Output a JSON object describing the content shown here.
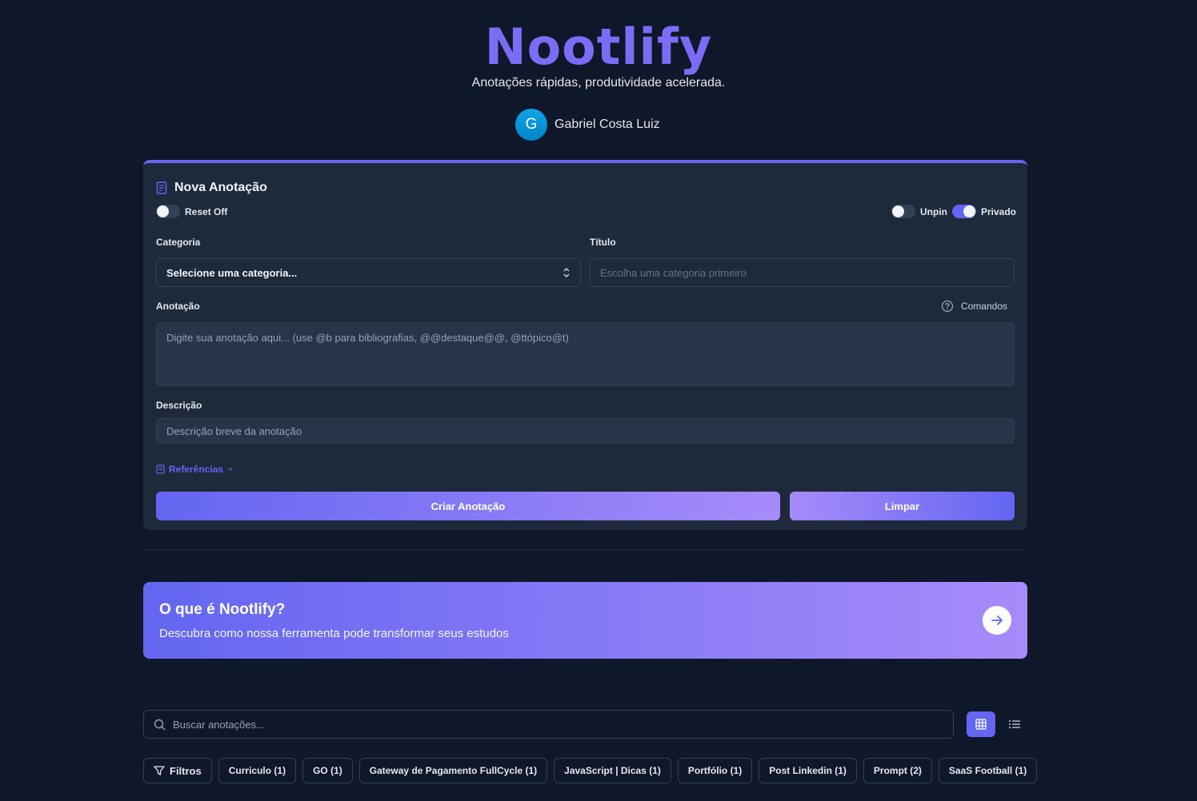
{
  "header": {
    "logo": "Nootlify",
    "tagline": "Anotações rápidas, produtividade acelerada.",
    "user_initial": "G",
    "user_name": "Gabriel Costa Luiz"
  },
  "form": {
    "title": "Nova Anotação",
    "reset_label": "Reset Off",
    "unpin_label": "Unpin",
    "private_label": "Privado",
    "category_label": "Categoria",
    "category_value": "Selecione uma categoria...",
    "title_label": "Título",
    "title_placeholder": "Escolha uma categoria primeiro",
    "note_label": "Anotação",
    "commands_label": "Comandos",
    "note_placeholder": "Digite sua anotação aqui... (use @b para bibliografias, @@destaque@@, @ttópico@t)",
    "description_label": "Descrição",
    "description_placeholder": "Descrição breve da anotação",
    "references_label": "Referências",
    "create_button": "Criar Anotação",
    "clear_button": "Limpar"
  },
  "banner": {
    "title": "O que é Nootlify?",
    "subtitle": "Descubra como nossa ferramenta pode transformar seus estudos"
  },
  "search": {
    "placeholder": "Buscar anotações..."
  },
  "filters": {
    "label": "Filtros",
    "chips": [
      "Curriculo (1)",
      "GO (1)",
      "Gateway de Pagamento FullCycle (1)",
      "JavaScript | Dicas (1)",
      "Portfólio (1)",
      "Post Linkedin (1)",
      "Prompt (2)",
      "SaaS Football (1)"
    ]
  },
  "colors": {
    "accent": "#6366f1",
    "accent_light": "#a78bfa",
    "background": "#0f172a",
    "card": "#1e293b"
  }
}
